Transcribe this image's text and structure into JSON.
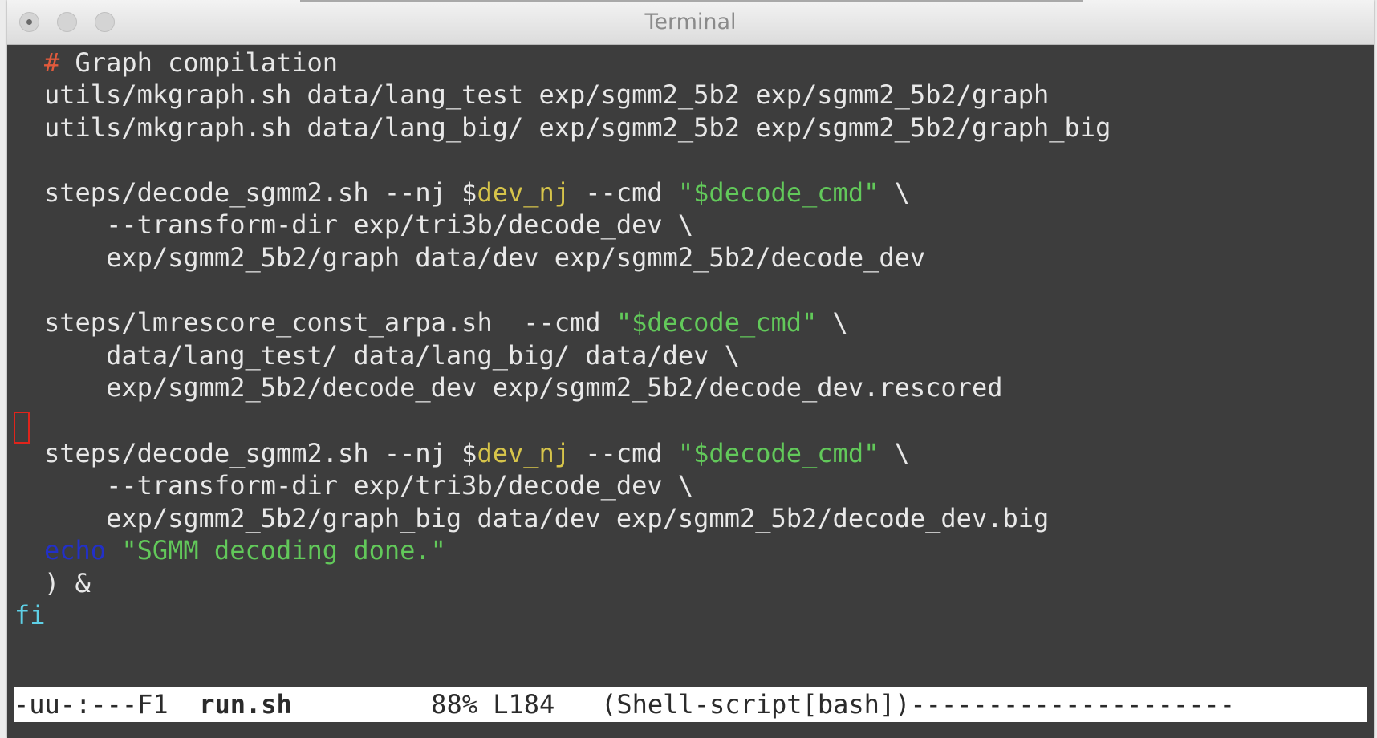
{
  "window": {
    "title": "Terminal"
  },
  "editor": {
    "lines": [
      {
        "mark": "# ",
        "text": "Graph compilation"
      },
      {
        "text": "utils/mkgraph.sh data/lang_test exp/sgmm2_5b2 exp/sgmm2_5b2/graph"
      },
      {
        "text": "utils/mkgraph.sh data/lang_big/ exp/sgmm2_5b2 exp/sgmm2_5b2/graph_big"
      },
      {
        "pre": "steps/decode_sgmm2.sh --nj $",
        "var": "dev_nj",
        "mid": " --cmd ",
        "str": "\"$decode_cmd\"",
        "post": " \\"
      },
      {
        "text": "    --transform-dir exp/tri3b/decode_dev \\"
      },
      {
        "text": "    exp/sgmm2_5b2/graph data/dev exp/sgmm2_5b2/decode_dev"
      },
      {
        "pre": "steps/lmrescore_const_arpa.sh  --cmd ",
        "str": "\"$decode_cmd\"",
        "post": " \\"
      },
      {
        "text": "    data/lang_test/ data/lang_big/ data/dev \\"
      },
      {
        "text": "    exp/sgmm2_5b2/decode_dev exp/sgmm2_5b2/decode_dev.rescored"
      },
      {
        "pre": "steps/decode_sgmm2.sh --nj $",
        "var": "dev_nj",
        "mid": " --cmd ",
        "str": "\"$decode_cmd\"",
        "post": " \\"
      },
      {
        "text": "    --transform-dir exp/tri3b/decode_dev \\"
      },
      {
        "text": "    exp/sgmm2_5b2/graph_big data/dev exp/sgmm2_5b2/decode_dev.big"
      },
      {
        "kw": "echo",
        "str": " \"SGMM decoding done.\""
      },
      {
        "text": ") &"
      },
      {
        "kw": "fi"
      }
    ]
  },
  "modeline": {
    "status": "-uu-:---F1  ",
    "filename": "run.sh",
    "position": "         88% L184   ",
    "mode": "(Shell-script[bash])",
    "fill": "---------------------"
  },
  "colors": {
    "background": "#3d3d3d",
    "text": "#e8e8e8",
    "comment": "#e05a3c",
    "variable": "#d6c44a",
    "string": "#62c95a",
    "keyword_echo": "#2230c8",
    "keyword_fi": "#5ed0e6",
    "cursor": "#e0241b"
  }
}
